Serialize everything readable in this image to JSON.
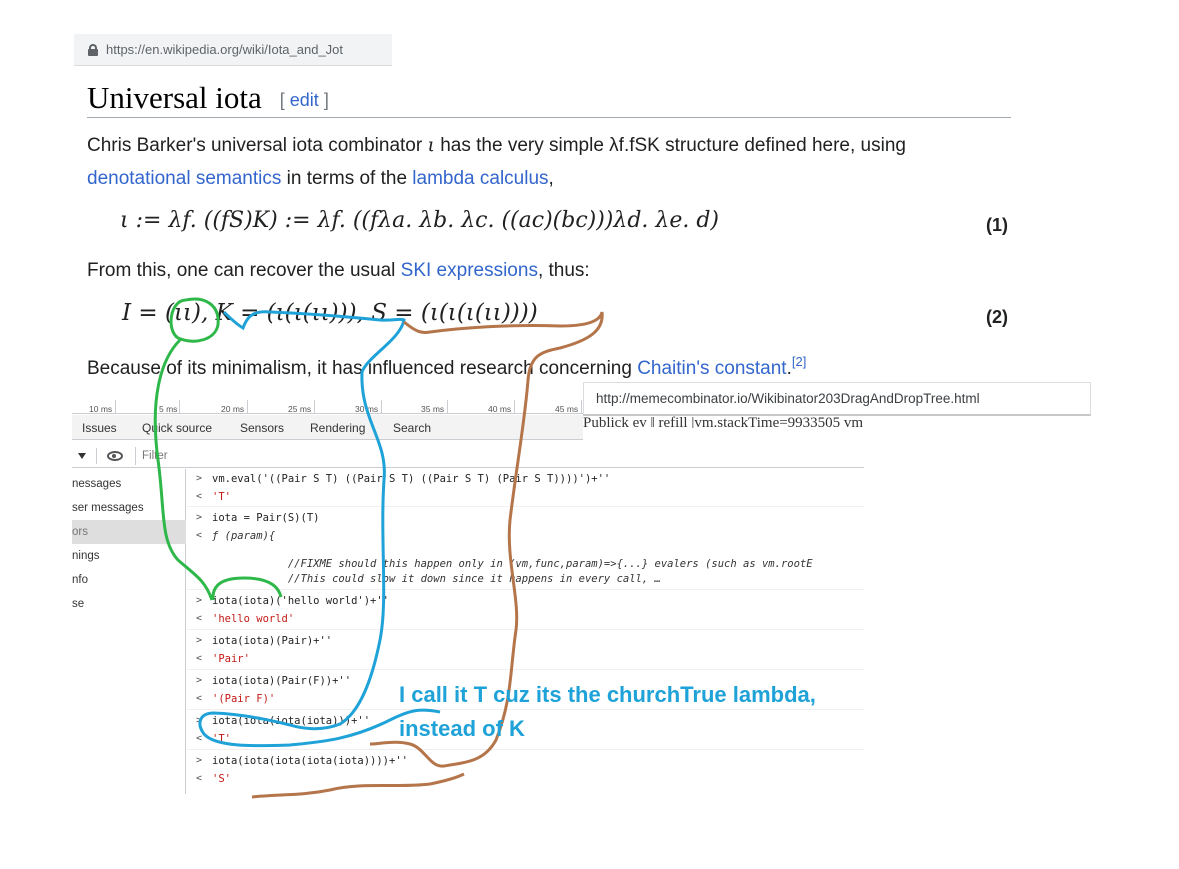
{
  "browser": {
    "wiki_url": "https://en.wikipedia.org/wiki/Iota_and_Jot",
    "meme_url": "http://memecombinator.io/Wikibinator203DragAndDropTree.html",
    "clipped_text": "Publick ev                                         ‖ refill   |vm.stackTime=9933505 vm"
  },
  "wiki": {
    "heading": "Universal iota",
    "edit_open": "[ ",
    "edit_link": "edit",
    "edit_close": " ]",
    "para1_a": "Chris Barker's universal iota combinator ",
    "iota_symbol": "ι",
    "para1_b": " has the very simple λf.fSK structure defined here, using",
    "link_denotational": "denotational semantics",
    "para1_c": " in terms of the ",
    "link_lambda": "lambda calculus",
    "para1_d": ",",
    "eq1": "ι := λf. ((fS)K) := λf. ((fλa. λb. λc. ((ac)(bc)))λd. λe. d)",
    "eq1_num": "(1)",
    "para2_a": "From this, one can recover the usual ",
    "link_ski": "SKI expressions",
    "para2_b": ", thus:",
    "eq2": "I = (ιι), K = (ι(ι(ιι))), S = (ι(ι(ι(ιι))))",
    "eq2_num": "(2)",
    "para3_a": "Because of its minimalism, it has influenced research concerning ",
    "link_chaitin": "Chaitin's constant",
    "para3_b": ".",
    "ref": "[2]"
  },
  "devtools": {
    "ticks": [
      "10 ms",
      "5 ms",
      "20 ms",
      "25 ms",
      "30 ms",
      "35 ms",
      "40 ms",
      "45 ms"
    ],
    "tabs": [
      "Issues",
      "Quick source",
      "Sensors",
      "Rendering",
      "Search"
    ],
    "filter_placeholder": "Filter",
    "sidebar": [
      "nessages",
      "ser messages",
      "ors",
      "nings",
      "nfo",
      "se"
    ],
    "console": [
      {
        "p": ">",
        "t": "vm.eval('((Pair S T) ((Pair S T) ((Pair S T) (Pair S T))))')+''"
      },
      {
        "p": "<",
        "t": "'T'",
        "cls": "str"
      },
      {
        "p": ">",
        "t": "iota = Pair(S)(T)"
      },
      {
        "p": "<",
        "t": "ƒ (param){",
        "cls": "fn"
      },
      {
        "p": "",
        "t": "            //FIXME should this happen only in (vm,func,param)=>{...} evalers (such as vm.rootE",
        "cls": "comment"
      },
      {
        "p": "",
        "t": "            //This could slow it down since it happens in every call, …",
        "cls": "comment"
      },
      {
        "p": ">",
        "t": "iota(iota)('hello world')+''"
      },
      {
        "p": "<",
        "t": "'hello world'",
        "cls": "str"
      },
      {
        "p": ">",
        "t": "iota(iota)(Pair)+''"
      },
      {
        "p": "<",
        "t": "'Pair'",
        "cls": "str"
      },
      {
        "p": ">",
        "t": "iota(iota)(Pair(F))+''"
      },
      {
        "p": "<",
        "t": "'(Pair F)'",
        "cls": "str"
      },
      {
        "p": ">",
        "t": "iota(iota(iota(iota)))+''"
      },
      {
        "p": "<",
        "t": "'T'",
        "cls": "str"
      },
      {
        "p": ">",
        "t": "iota(iota(iota(iota(iota))))+''"
      },
      {
        "p": "<",
        "t": "'S'",
        "cls": "str"
      }
    ]
  },
  "annotation": {
    "note": "I call it T cuz its the churchTrue lambda, instead of K",
    "blue": "#1ea2d8",
    "green": "#2fb84a",
    "brown": "#b5754a"
  }
}
